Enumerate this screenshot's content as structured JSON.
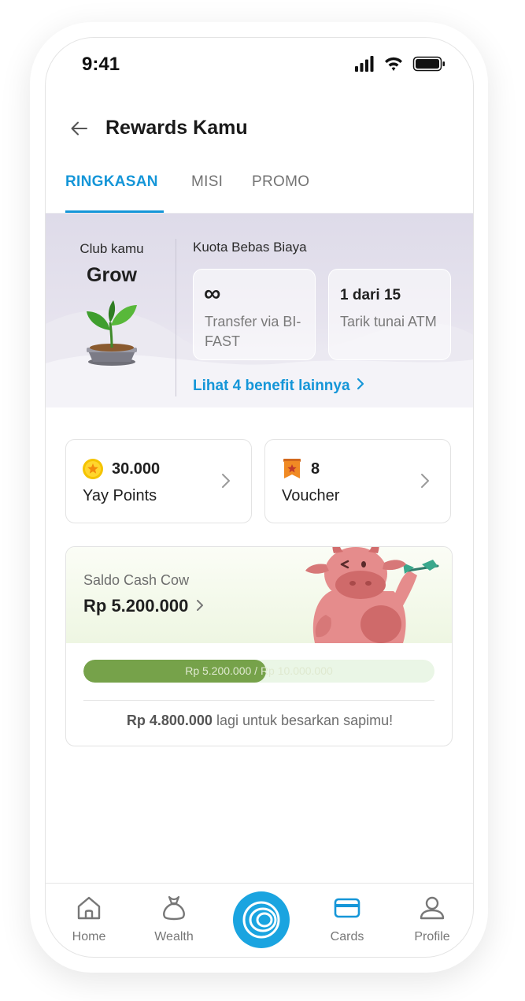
{
  "status_bar": {
    "time": "9:41",
    "icons": [
      "signal-icon",
      "wifi-icon",
      "battery-icon"
    ]
  },
  "header": {
    "back_icon": "back-arrow-icon",
    "title": "Rewards Kamu"
  },
  "tabs": [
    {
      "label": "RINGKASAN",
      "active": true
    },
    {
      "label": "MISI",
      "active": false
    },
    {
      "label": "PROMO",
      "active": false
    }
  ],
  "club": {
    "label": "Club kamu",
    "name": "Grow",
    "icon": "plant-icon",
    "quota_title": "Kuota Bebas Biaya",
    "quotas": [
      {
        "value": "∞",
        "description": "Transfer via BI-FAST"
      },
      {
        "value": "1 dari 15",
        "description": "Tarik tunai ATM"
      }
    ],
    "benefit_link": "Lihat 4 benefit lainnya"
  },
  "points": {
    "yay": {
      "value": "30.000",
      "label": "Yay Points",
      "icon": "star-coin-icon"
    },
    "voucher": {
      "value": "8",
      "label": "Voucher",
      "icon": "voucher-ribbon-icon"
    }
  },
  "cash_cow": {
    "label": "Saldo Cash Cow",
    "amount": "Rp 5.200.000",
    "progress_text": "Rp 5.200.000 / Rp 10.000.000",
    "progress_fraction": 0.52,
    "remaining_amount": "Rp 4.800.000",
    "remaining_text": "lagi untuk besarkan sapimu!",
    "colors": {
      "fill": "#76a24a",
      "track": "#eaf6e6"
    }
  },
  "bottom_nav": {
    "items": [
      {
        "label": "Home",
        "icon": "home-icon",
        "active": false
      },
      {
        "label": "Wealth",
        "icon": "money-bag-icon",
        "active": false
      },
      {
        "label": "",
        "icon": "rings-logo-icon",
        "active": false
      },
      {
        "label": "Cards",
        "icon": "card-icon",
        "active": true
      },
      {
        "label": "Profile",
        "icon": "profile-icon",
        "active": false
      }
    ]
  },
  "colors": {
    "accent": "#1596d8",
    "center_button": "#1aa4e0"
  }
}
